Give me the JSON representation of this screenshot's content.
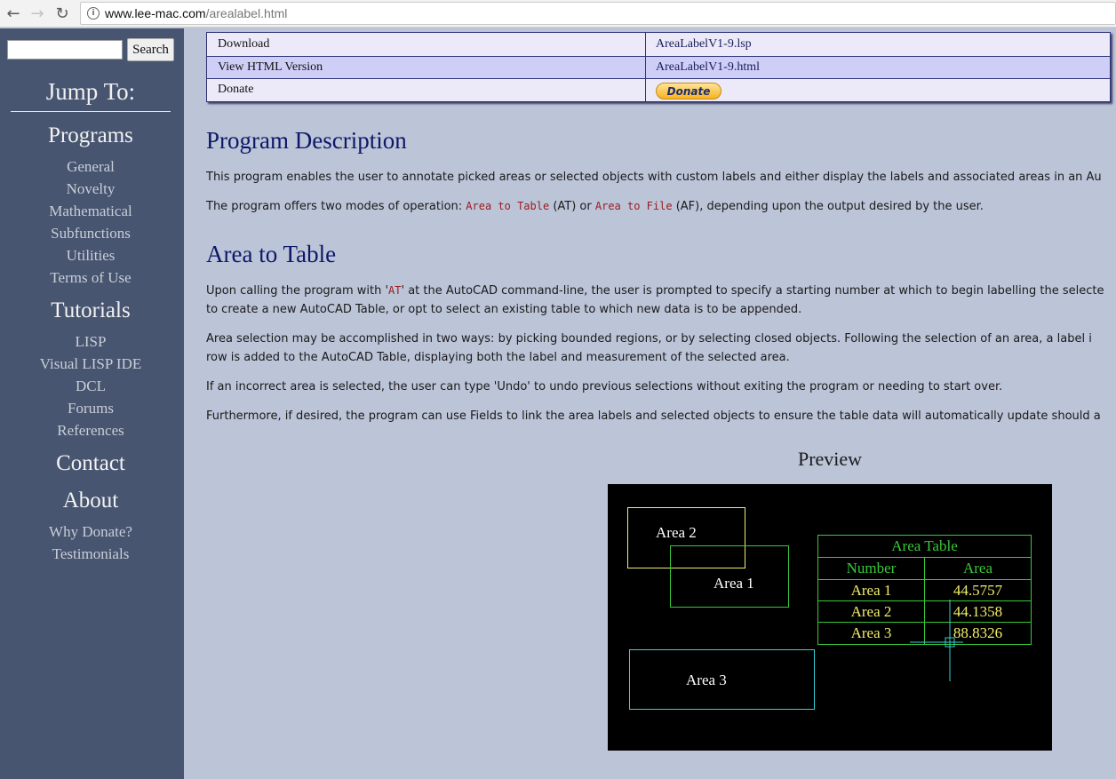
{
  "browser": {
    "url_host": "www.lee-mac.com",
    "url_path": "/arealabel.html"
  },
  "sidebar": {
    "search_button": "Search",
    "jump_to": "Jump To:",
    "programs": {
      "heading": "Programs",
      "items": [
        "General",
        "Novelty",
        "Mathematical",
        "Subfunctions",
        "Utilities",
        "Terms of Use"
      ]
    },
    "tutorials": {
      "heading": "Tutorials",
      "items": [
        "LISP",
        "Visual LISP IDE",
        "DCL",
        "Forums",
        "References"
      ]
    },
    "contact": "Contact",
    "about": {
      "heading": "About",
      "items": [
        "Why Donate?",
        "Testimonials"
      ]
    }
  },
  "downloads_table": {
    "rows": [
      {
        "label": "Download",
        "value": "AreaLabelV1-9.lsp"
      },
      {
        "label": "View HTML Version",
        "value": "AreaLabelV1-9.html"
      },
      {
        "label": "Donate",
        "button": "Donate"
      }
    ]
  },
  "program_description": {
    "heading": "Program Description",
    "p1": "This program enables the user to annotate picked areas or selected objects with custom labels and either display the labels and associated areas in an Au",
    "p2_before": "The program offers two modes of operation: ",
    "p2_code1": "Area to Table",
    "p2_mid1": " (AT) or ",
    "p2_code2": "Area to File",
    "p2_after": " (AF), depending upon the output desired by the user."
  },
  "area_to_table": {
    "heading": "Area to Table",
    "p1_l1_before": "Upon calling the program with '",
    "p1_l1_code": "AT",
    "p1_l1_after": "' at the AutoCAD command-line, the user is prompted to specify a starting number at which to begin labelling the selecte",
    "p1_l2": "to create a new AutoCAD Table, or opt to select an existing table to which new data is to be appended.",
    "p2_l1": "Area selection may be accomplished in two ways: by picking bounded regions, or by selecting closed objects. Following the selection of an area, a label i",
    "p2_l2": "row is added to the AutoCAD Table, displaying both the label and measurement of the selected area.",
    "p3": "If an incorrect area is selected, the user can type 'Undo' to undo previous selections without exiting the program or needing to start over.",
    "p4": "Furthermore, if desired, the program can use Fields to link the area labels and selected objects to ensure the table data will automatically update should a"
  },
  "preview": {
    "title": "Preview",
    "labels": {
      "area2": "Area 2",
      "area1": "Area 1",
      "area3": "Area 3"
    },
    "table": {
      "title": "Area Table",
      "headers": [
        "Number",
        "Area"
      ],
      "rows": [
        {
          "number": "Area 1",
          "area": "44.5757"
        },
        {
          "number": "Area 2",
          "area": "44.1358"
        },
        {
          "number": "Area 3",
          "area": "88.8326"
        }
      ]
    },
    "colors": {
      "yellow": "#f2ee6a",
      "green": "#39c839",
      "cyan": "#36d2d8"
    }
  }
}
